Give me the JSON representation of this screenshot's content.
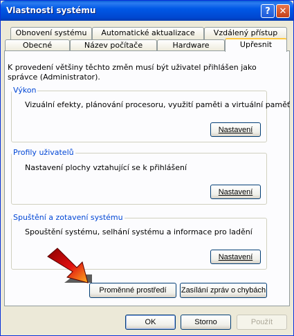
{
  "window": {
    "title": "Vlastnosti systému"
  },
  "titlebar_buttons": {
    "help": "?",
    "close": "✕"
  },
  "tabs_row1": [
    "Obnovení systému",
    "Automatické aktualizace",
    "Vzdálený přístup"
  ],
  "tabs_row2": [
    "Obecné",
    "Název počítače",
    "Hardware",
    "Upřesnit"
  ],
  "active_tab": "Upřesnit",
  "intro": "K provedení většiny těchto změn musí být uživatel přihlášen jako správce (Administrator).",
  "groups": {
    "performance": {
      "label": "Výkon",
      "text": "Vizuální efekty, plánování procesoru, využití paměti a virtuální paměť",
      "button": "Nastavení"
    },
    "profiles": {
      "label": "Profily uživatelů",
      "text": "Nastavení plochy vztahující se k přihlášení",
      "button": "Nastavení"
    },
    "startup": {
      "label": "Spuštění a zotavení systému",
      "text": "Spouštění systému, selhání systému a informace pro ladění",
      "button": "Nastavení"
    }
  },
  "env_button": "Proměnné prostředí",
  "error_button": "Zasílání zpráv o chybách",
  "footer": {
    "ok": "OK",
    "cancel": "Storno",
    "apply": "Použít"
  }
}
